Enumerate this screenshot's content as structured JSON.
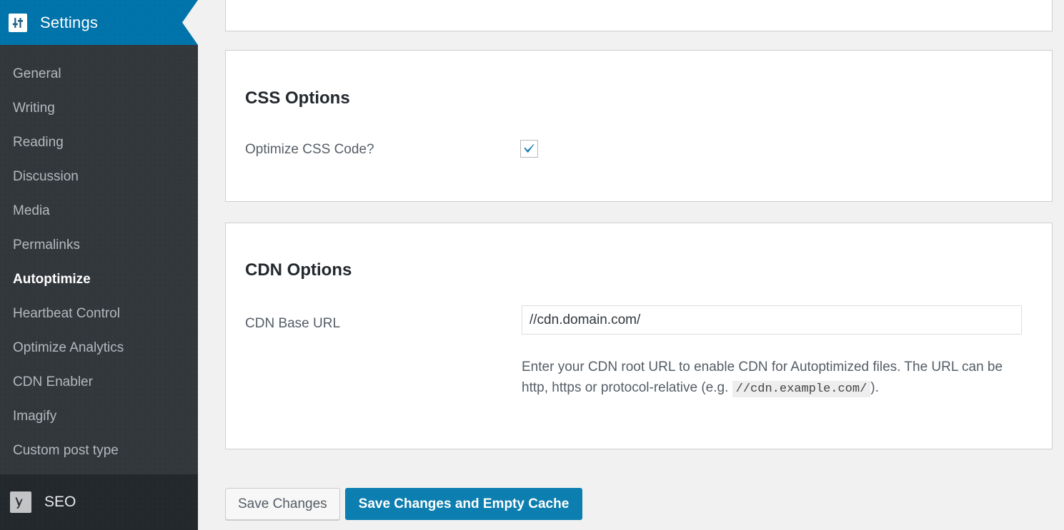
{
  "sidebar": {
    "header": {
      "title": "Settings",
      "icon": "settings-sliders-icon",
      "bg_color": "#0073aa"
    },
    "items": [
      {
        "label": "General",
        "active": false
      },
      {
        "label": "Writing",
        "active": false
      },
      {
        "label": "Reading",
        "active": false
      },
      {
        "label": "Discussion",
        "active": false
      },
      {
        "label": "Media",
        "active": false
      },
      {
        "label": "Permalinks",
        "active": false
      },
      {
        "label": "Autoptimize",
        "active": true
      },
      {
        "label": "Heartbeat Control",
        "active": false
      },
      {
        "label": "Optimize Analytics",
        "active": false
      },
      {
        "label": "CDN Enabler",
        "active": false
      },
      {
        "label": "Imagify",
        "active": false
      },
      {
        "label": "Custom post type",
        "active": false
      }
    ],
    "footer": {
      "label": "SEO",
      "icon": "yoast-seo-icon"
    },
    "bg_color": "#32373c"
  },
  "main": {
    "css_options": {
      "title": "CSS Options",
      "optimize_css": {
        "label": "Optimize CSS Code?",
        "checked": true,
        "check_color": "#1d7fb3"
      }
    },
    "cdn_options": {
      "title": "CDN Options",
      "base_url": {
        "label": "CDN Base URL",
        "value": "//cdn.domain.com/",
        "placeholder": "",
        "description_part1": "Enter your CDN root URL to enable CDN for Autoptimized files. The URL can be http, https or protocol-relative (e.g.",
        "description_code": "//cdn.example.com/",
        "description_part2": ")."
      }
    },
    "buttons": {
      "save": "Save Changes",
      "save_and_empty": "Save Changes and Empty Cache",
      "primary_color": "#0d7eb0"
    }
  }
}
